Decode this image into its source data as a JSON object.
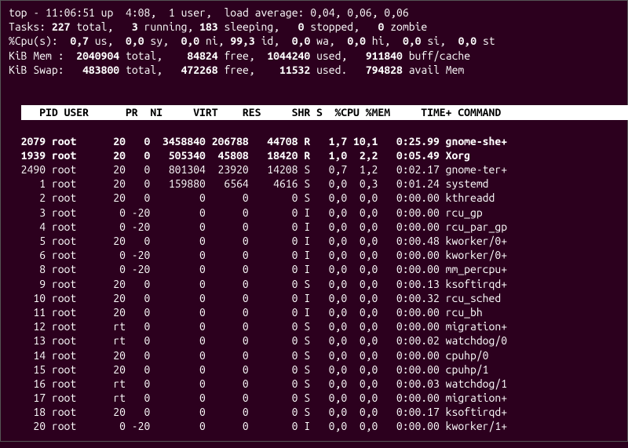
{
  "summary": {
    "line1_prefix": "top - ",
    "time": "11:06:51",
    "uptime_label": " up  ",
    "uptime": "4:08",
    "users_sep": ",  ",
    "users": "1 user",
    "load_label": ",  load average: ",
    "load": "0,04, 0,06, 0,06",
    "tasks_label": "Tasks:",
    "tasks_total": "227",
    "tasks_total_lbl": "total,",
    "tasks_running": "3",
    "tasks_running_lbl": "running,",
    "tasks_sleeping": "183",
    "tasks_sleeping_lbl": "sleeping,",
    "tasks_stopped": "0",
    "tasks_stopped_lbl": "stopped,",
    "tasks_zombie": "0",
    "tasks_zombie_lbl": "zombie",
    "cpu_label": "%Cpu(s):",
    "cpu_us": "0,7",
    "cpu_us_lbl": "us,",
    "cpu_sy": "0,0",
    "cpu_sy_lbl": "sy,",
    "cpu_ni": "0,0",
    "cpu_ni_lbl": "ni,",
    "cpu_id": "99,3",
    "cpu_id_lbl": "id,",
    "cpu_wa": "0,0",
    "cpu_wa_lbl": "wa,",
    "cpu_hi": "0,0",
    "cpu_hi_lbl": "hi,",
    "cpu_si": "0,0",
    "cpu_si_lbl": "si,",
    "cpu_st": "0,0",
    "cpu_st_lbl": "st",
    "mem_label": "KiB Mem :",
    "mem_total": "2040904",
    "mem_total_lbl": "total,",
    "mem_free": "84824",
    "mem_free_lbl": "free,",
    "mem_used": "1044240",
    "mem_used_lbl": "used,",
    "mem_buff": "911840",
    "mem_buff_lbl": "buff/cache",
    "swap_label": "KiB Swap:",
    "swap_total": "483800",
    "swap_total_lbl": "total,",
    "swap_free": "472268",
    "swap_free_lbl": "free,",
    "swap_used": "11532",
    "swap_used_lbl": "used.",
    "swap_avail": "794828",
    "swap_avail_lbl": "avail Mem"
  },
  "columns": [
    "PID",
    "USER",
    "PR",
    "NI",
    "VIRT",
    "RES",
    "SHR",
    "S",
    "%CPU",
    "%MEM",
    "TIME+",
    "COMMAND"
  ],
  "rows": [
    {
      "hi": true,
      "pid": "2079",
      "user": "root",
      "pr": "20",
      "ni": "0",
      "virt": "3458840",
      "res": "206788",
      "shr": "44708",
      "s": "R",
      "cpu": "1,7",
      "mem": "10,1",
      "time": "0:25.99",
      "cmd": "gnome-she+"
    },
    {
      "hi": true,
      "pid": "1939",
      "user": "root",
      "pr": "20",
      "ni": "0",
      "virt": "505340",
      "res": "45808",
      "shr": "18420",
      "s": "R",
      "cpu": "1,0",
      "mem": "2,2",
      "time": "0:05.49",
      "cmd": "Xorg"
    },
    {
      "pid": "2490",
      "user": "root",
      "pr": "20",
      "ni": "0",
      "virt": "801304",
      "res": "23920",
      "shr": "14208",
      "s": "S",
      "cpu": "0,7",
      "mem": "1,2",
      "time": "0:02.17",
      "cmd": "gnome-ter+"
    },
    {
      "pid": "1",
      "user": "root",
      "pr": "20",
      "ni": "0",
      "virt": "159880",
      "res": "6564",
      "shr": "4616",
      "s": "S",
      "cpu": "0,0",
      "mem": "0,3",
      "time": "0:01.24",
      "cmd": "systemd"
    },
    {
      "pid": "2",
      "user": "root",
      "pr": "20",
      "ni": "0",
      "virt": "0",
      "res": "0",
      "shr": "0",
      "s": "S",
      "cpu": "0,0",
      "mem": "0,0",
      "time": "0:00.00",
      "cmd": "kthreadd"
    },
    {
      "pid": "3",
      "user": "root",
      "pr": "0",
      "ni": "-20",
      "virt": "0",
      "res": "0",
      "shr": "0",
      "s": "I",
      "cpu": "0,0",
      "mem": "0,0",
      "time": "0:00.00",
      "cmd": "rcu_gp"
    },
    {
      "pid": "4",
      "user": "root",
      "pr": "0",
      "ni": "-20",
      "virt": "0",
      "res": "0",
      "shr": "0",
      "s": "I",
      "cpu": "0,0",
      "mem": "0,0",
      "time": "0:00.00",
      "cmd": "rcu_par_gp"
    },
    {
      "pid": "5",
      "user": "root",
      "pr": "20",
      "ni": "0",
      "virt": "0",
      "res": "0",
      "shr": "0",
      "s": "I",
      "cpu": "0,0",
      "mem": "0,0",
      "time": "0:00.48",
      "cmd": "kworker/0+"
    },
    {
      "pid": "6",
      "user": "root",
      "pr": "0",
      "ni": "-20",
      "virt": "0",
      "res": "0",
      "shr": "0",
      "s": "I",
      "cpu": "0,0",
      "mem": "0,0",
      "time": "0:00.00",
      "cmd": "kworker/0+"
    },
    {
      "pid": "8",
      "user": "root",
      "pr": "0",
      "ni": "-20",
      "virt": "0",
      "res": "0",
      "shr": "0",
      "s": "I",
      "cpu": "0,0",
      "mem": "0,0",
      "time": "0:00.00",
      "cmd": "mm_percpu+"
    },
    {
      "pid": "9",
      "user": "root",
      "pr": "20",
      "ni": "0",
      "virt": "0",
      "res": "0",
      "shr": "0",
      "s": "S",
      "cpu": "0,0",
      "mem": "0,0",
      "time": "0:00.13",
      "cmd": "ksoftirqd+"
    },
    {
      "pid": "10",
      "user": "root",
      "pr": "20",
      "ni": "0",
      "virt": "0",
      "res": "0",
      "shr": "0",
      "s": "I",
      "cpu": "0,0",
      "mem": "0,0",
      "time": "0:00.32",
      "cmd": "rcu_sched"
    },
    {
      "pid": "11",
      "user": "root",
      "pr": "20",
      "ni": "0",
      "virt": "0",
      "res": "0",
      "shr": "0",
      "s": "I",
      "cpu": "0,0",
      "mem": "0,0",
      "time": "0:00.00",
      "cmd": "rcu_bh"
    },
    {
      "pid": "12",
      "user": "root",
      "pr": "rt",
      "ni": "0",
      "virt": "0",
      "res": "0",
      "shr": "0",
      "s": "S",
      "cpu": "0,0",
      "mem": "0,0",
      "time": "0:00.00",
      "cmd": "migration+"
    },
    {
      "pid": "13",
      "user": "root",
      "pr": "rt",
      "ni": "0",
      "virt": "0",
      "res": "0",
      "shr": "0",
      "s": "S",
      "cpu": "0,0",
      "mem": "0,0",
      "time": "0:00.02",
      "cmd": "watchdog/0"
    },
    {
      "pid": "14",
      "user": "root",
      "pr": "20",
      "ni": "0",
      "virt": "0",
      "res": "0",
      "shr": "0",
      "s": "S",
      "cpu": "0,0",
      "mem": "0,0",
      "time": "0:00.00",
      "cmd": "cpuhp/0"
    },
    {
      "pid": "15",
      "user": "root",
      "pr": "20",
      "ni": "0",
      "virt": "0",
      "res": "0",
      "shr": "0",
      "s": "S",
      "cpu": "0,0",
      "mem": "0,0",
      "time": "0:00.00",
      "cmd": "cpuhp/1"
    },
    {
      "pid": "16",
      "user": "root",
      "pr": "rt",
      "ni": "0",
      "virt": "0",
      "res": "0",
      "shr": "0",
      "s": "S",
      "cpu": "0,0",
      "mem": "0,0",
      "time": "0:00.03",
      "cmd": "watchdog/1"
    },
    {
      "pid": "17",
      "user": "root",
      "pr": "rt",
      "ni": "0",
      "virt": "0",
      "res": "0",
      "shr": "0",
      "s": "S",
      "cpu": "0,0",
      "mem": "0,0",
      "time": "0:00.00",
      "cmd": "migration+"
    },
    {
      "pid": "18",
      "user": "root",
      "pr": "20",
      "ni": "0",
      "virt": "0",
      "res": "0",
      "shr": "0",
      "s": "S",
      "cpu": "0,0",
      "mem": "0,0",
      "time": "0:00.17",
      "cmd": "ksoftirqd+"
    },
    {
      "pid": "20",
      "user": "root",
      "pr": "0",
      "ni": "-20",
      "virt": "0",
      "res": "0",
      "shr": "0",
      "s": "I",
      "cpu": "0,0",
      "mem": "0,0",
      "time": "0:00.00",
      "cmd": "kworker/1+"
    }
  ]
}
